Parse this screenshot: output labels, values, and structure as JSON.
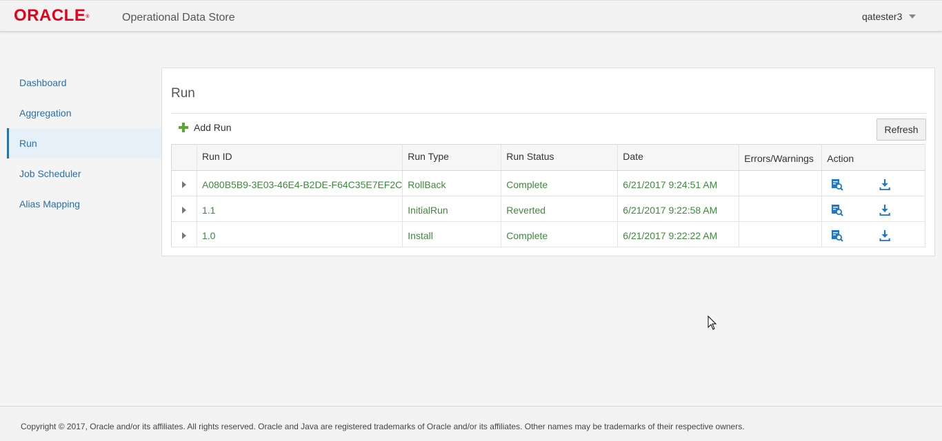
{
  "header": {
    "logo_text": "ORACLE",
    "logo_mark": "®",
    "app_title": "Operational Data Store",
    "username": "qatester3"
  },
  "sidebar": {
    "items": [
      {
        "label": "Dashboard",
        "active": false
      },
      {
        "label": "Aggregation",
        "active": false
      },
      {
        "label": "Run",
        "active": true
      },
      {
        "label": "Job Scheduler",
        "active": false
      },
      {
        "label": "Alias Mapping",
        "active": false
      }
    ]
  },
  "main": {
    "title": "Run",
    "add_label": "Add Run",
    "refresh_label": "Refresh",
    "columns": [
      "Run ID",
      "Run Type",
      "Run Status",
      "Date",
      "Errors/Warnings",
      "Action"
    ],
    "rows": [
      {
        "run_id": "A080B5B9-3E03-46E4-B2DE-F64C35E7EF2C",
        "run_type": "RollBack",
        "status": "Complete",
        "date": "6/21/2017 9:24:51 AM",
        "errors": ""
      },
      {
        "run_id": "1.1",
        "run_type": "InitialRun",
        "status": "Reverted",
        "date": "6/21/2017 9:22:58 AM",
        "errors": ""
      },
      {
        "run_id": "1.0",
        "run_type": "Install",
        "status": "Complete",
        "date": "6/21/2017 9:22:22 AM",
        "errors": ""
      }
    ],
    "action_icons": [
      "view-details-icon",
      "download-icon"
    ]
  },
  "footer": {
    "copyright": "Copyright © 2017, Oracle and/or its affiliates. All rights reserved. Oracle and Java are registered trademarks of Oracle and/or its affiliates. Other names may be trademarks of their respective owners."
  },
  "colors": {
    "brand_red": "#e3001b",
    "link_blue": "#2a6eaa",
    "status_green": "#3c8a3c",
    "add_green": "#5aa832",
    "icon_blue": "#1f77c9"
  }
}
